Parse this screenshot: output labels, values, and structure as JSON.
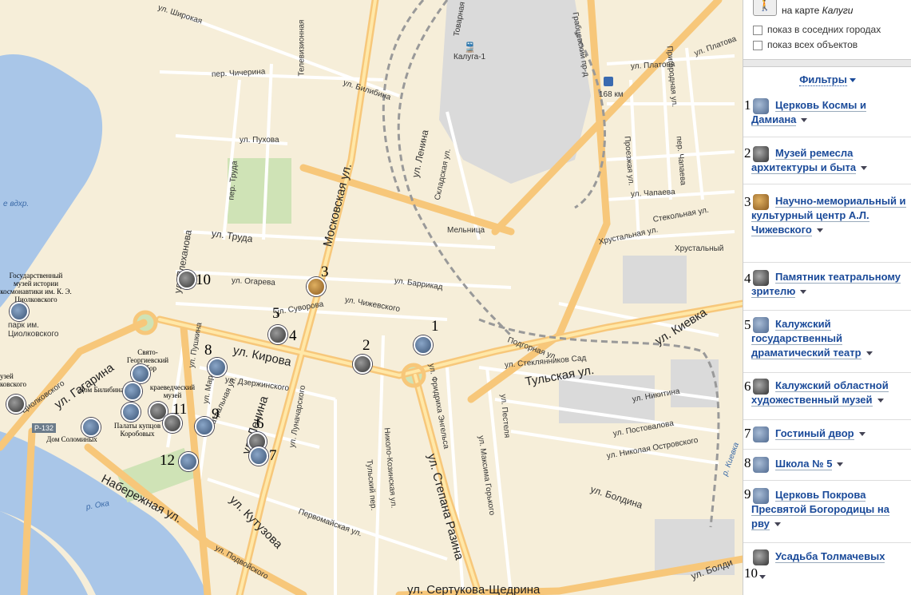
{
  "map": {
    "streets": {
      "shirokaya": "ул. Широкая",
      "televizionnaya": "Телевизионная",
      "chicherina": "пер. Чичерина",
      "bilibina": "ул. Билибина",
      "puhova": "ул. Пухова",
      "truda_per": "пер. Труда",
      "truda": "ул. Труда",
      "moskovskaya": "Московская ул.",
      "lenina_top": "ул. Ленина",
      "skladskaya": "Складская ул.",
      "tovarnaya": "Товарная",
      "grabtsevskiy": "Грабцевский пр-д",
      "platova": "ул. Платова",
      "prigorodnaya": "Пригородная ул.",
      "proezzhaya": "Проезжая ул.",
      "chapaeva_per": "пер. Чапаева",
      "chapaeva": "ул. Чапаева",
      "steklonaya": "Стекольная ул.",
      "hrustalnaya_ul": "Хрустальная ул.",
      "hrustalny": "Хрустальный",
      "melnitsa": "Мельница",
      "ogareva": "ул. Огарева",
      "barrikad": "ул. Баррикад",
      "suvorova": "ул. Суворова",
      "chizhevskogo": "ул. Чижевского",
      "kirova": "ул. Кирова",
      "dzerzhinskogo": "ул. Дзержинского",
      "gagarina": "ул. Гагарина",
      "tiolkovskogo": "Циолковского",
      "podgornaya": "Подгорная ул.",
      "steklyannikov": "ул. Стеклянников Сад",
      "tulskaya": "Тульская ул.",
      "kievka": "ул. Киевка",
      "nikitina": "ул. Никитина",
      "postovalova": "ул. Постовалова",
      "n_ostrovskogo": "ул. Николая Островского",
      "lenina_bottom": "ул. Ленина",
      "lunacharskogo": "ул. Луначарского",
      "tulsky_per": "Тульский пер.",
      "nikolo_kozinskaya": "Николо-Козинская ул.",
      "fr_engelsa": "ул. Фридриха Энгельса",
      "st_razina": "ул. Степана Разина",
      "pestelya": "ул. Пестеля",
      "m_gorkogo": "ул. Максима Горького",
      "boldina": "ул. Болдина",
      "boldina2": "ул. Болди",
      "teatralnaya": "Театральная ул.",
      "naberezhnaya": "Набережная ул.",
      "kutuzova": "ул. Кутузова",
      "pervomayskaya": "Первомайская ул.",
      "podvoyskogo": "ул. Подвойского",
      "sertsova": "ул. Сертукова-Щедрина",
      "plekhanova": "ул. Плеханова",
      "marata": "ул. Марата",
      "pushkina": "ул. Пушкина"
    },
    "water": {
      "vdhr": "е вдхр.",
      "oka": "р. Ока",
      "kievka_river": "р. Киевка"
    },
    "poi": {
      "station": "Калуга-1",
      "km": "168 км",
      "route": "Р-132",
      "park": "парк им. Циолковского",
      "museum_cosmo": "Государственный музей истории космонавтики им. К. Э. Циолковского",
      "svyato_georg": "Свято-Георгиевский собор",
      "dom_golitsyna": "Дом Билибина",
      "kraeved": "краеведческий музей",
      "palaty": "Палаты купцов Коробовых",
      "dom_solomina": "Дом Соломиных",
      "museum_left": "узей\nковского"
    },
    "markers": [
      {
        "n": "1"
      },
      {
        "n": "2"
      },
      {
        "n": "3"
      },
      {
        "n": "4"
      },
      {
        "n": "5"
      },
      {
        "n": "6"
      },
      {
        "n": "7"
      },
      {
        "n": "8"
      },
      {
        "n": "9"
      },
      {
        "n": "10"
      },
      {
        "n": "11"
      },
      {
        "n": "12"
      }
    ]
  },
  "panel": {
    "city_prefix": "на карте",
    "city": "Калуги",
    "checkbox_neighbors": "показ в соседних городах",
    "checkbox_all": "показ всех объектов",
    "filters_label": "Фильтры",
    "items": [
      {
        "num": "1",
        "name": "Церковь Космы и Дамиана"
      },
      {
        "num": "2",
        "name": "Музей ремесла архитектуры и быта"
      },
      {
        "num": "3",
        "name": "Научно-мемориальный и культурный центр А.Л. Чижевского"
      },
      {
        "num": "4",
        "name": "Памятник театральному зрителю"
      },
      {
        "num": "5",
        "name": "Калужский государственный драматический театр"
      },
      {
        "num": "6",
        "name": "Калужский областной художественный музей"
      },
      {
        "num": "7",
        "name": "Гостиный двор"
      },
      {
        "num": "8",
        "name": "Школа № 5"
      },
      {
        "num": "9",
        "name": "Церковь Покрова Пресвятой Богородицы на рву"
      },
      {
        "num": "10",
        "name": "Усадьба Толмачевых"
      }
    ]
  }
}
